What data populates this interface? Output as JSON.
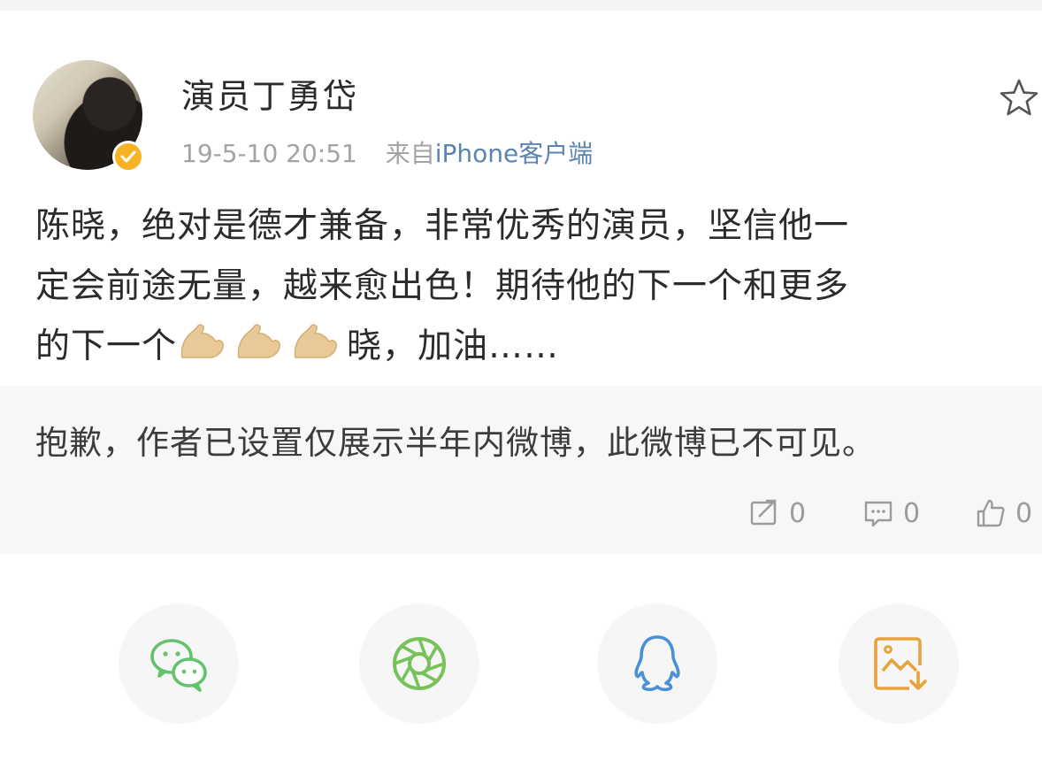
{
  "post": {
    "author": "演员丁勇岱",
    "timestamp": "19-5-10 20:51",
    "source_prefix": "来自",
    "source_app": "iPhone客户端",
    "content_lines": [
      "陈晓，绝对是德才兼备，非常优秀的演员，坚信他一",
      "定会前途无量，越来愈出色！期待他的下一个和更多",
      "的下一个"
    ],
    "content_tail": "晓，加油……",
    "emoji": "flexed-biceps",
    "emoji_count": 3
  },
  "retweet": {
    "notice": "抱歉，作者已设置仅展示半年内微博，此微博已不可见。",
    "stats": {
      "repost_count": "0",
      "comment_count": "0",
      "like_count": "0"
    }
  },
  "share_targets": [
    "wechat-icon",
    "moments-icon",
    "qq-icon",
    "save-image-icon"
  ],
  "colors": {
    "accent_link": "#5b84b1",
    "verified_badge": "#f7b324",
    "wechat": "#63c26b",
    "moments": "#77c35a",
    "qq": "#4a90d9",
    "save": "#e8a23a"
  }
}
